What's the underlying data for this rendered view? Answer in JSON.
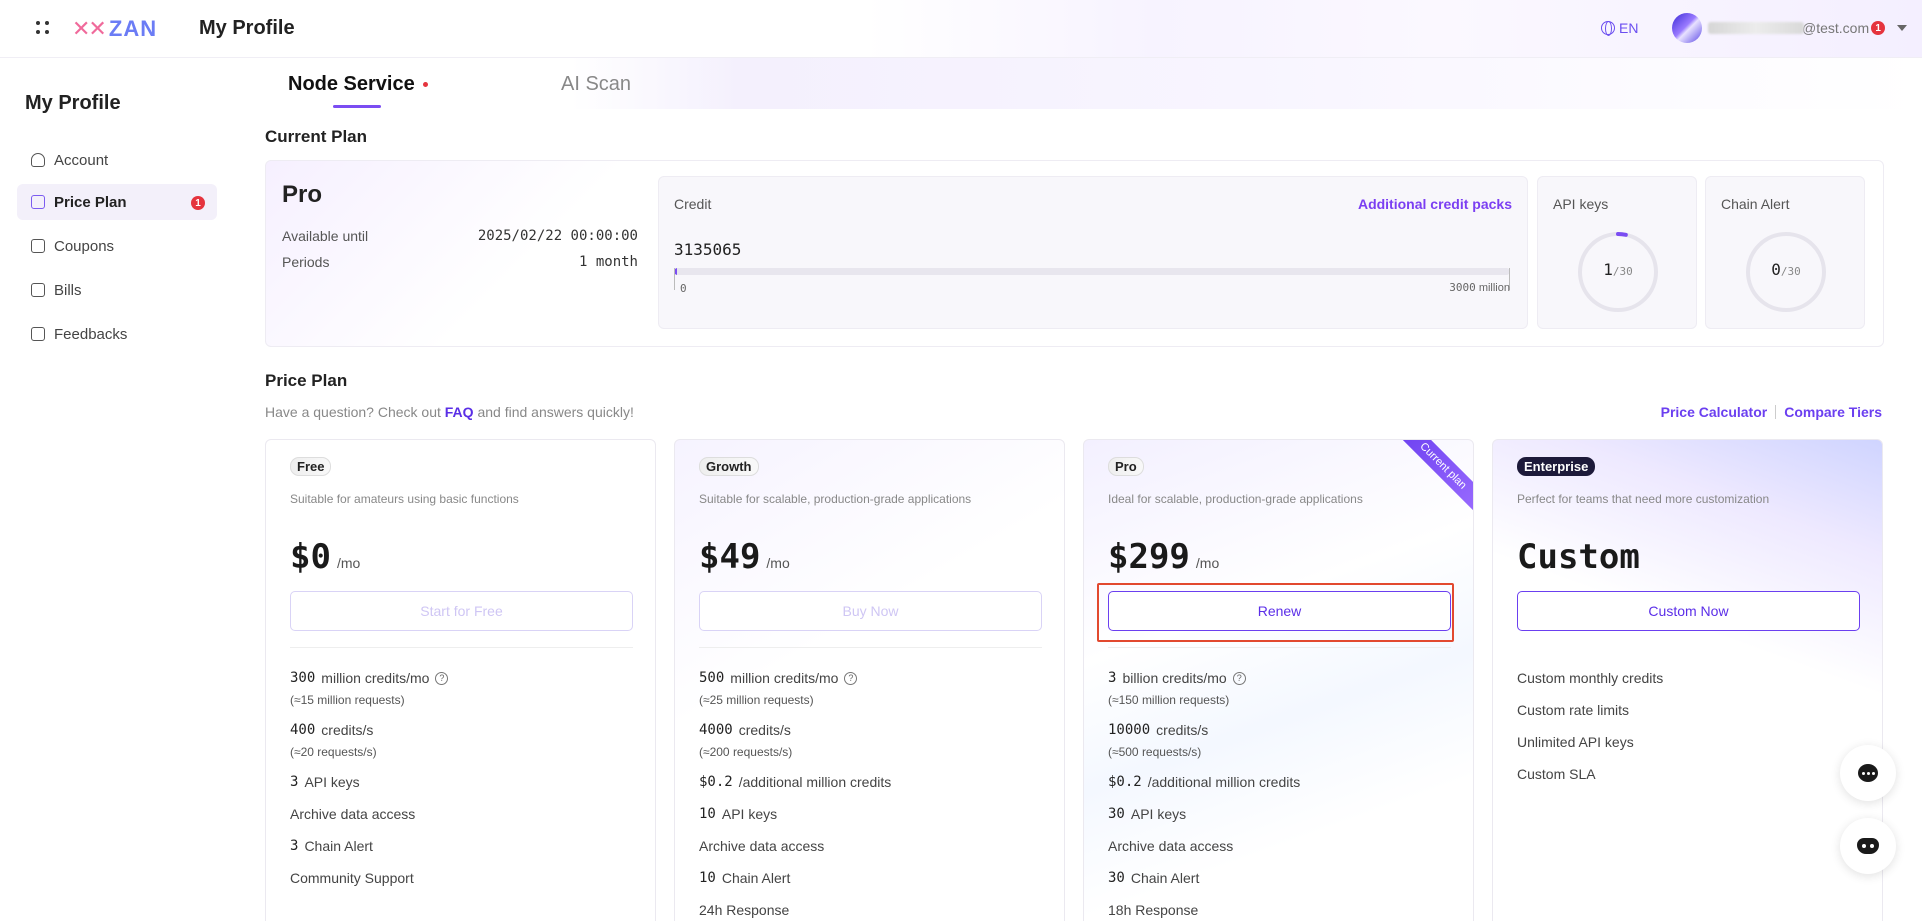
{
  "header": {
    "title": "My Profile",
    "logo": "ZAN",
    "lang": "EN",
    "email_suffix": "@test.com",
    "notif_count": "1"
  },
  "sidebar": {
    "title": "My Profile",
    "items": [
      {
        "label": "Account",
        "icon": "user-icon"
      },
      {
        "label": "Price Plan",
        "icon": "wallet-icon",
        "badge": "1"
      },
      {
        "label": "Coupons",
        "icon": "ticket-icon"
      },
      {
        "label": "Bills",
        "icon": "receipt-icon"
      },
      {
        "label": "Feedbacks",
        "icon": "message-icon"
      }
    ]
  },
  "tabs": {
    "node": "Node Service",
    "ai": "AI Scan"
  },
  "current_plan": {
    "section_title": "Current Plan",
    "name": "Pro",
    "available_label": "Available until",
    "available_value": "2025/02/22 00:00:00",
    "periods_label": "Periods",
    "periods_value": "1 month",
    "credit_label": "Credit",
    "credit_link": "Additional credit packs",
    "credit_value": "3135065",
    "credit_fraction": 0.001,
    "bar_min": "0",
    "bar_max_num": "3000",
    "bar_max_unit": "million",
    "api_keys_label": "API keys",
    "api_keys_used": "1",
    "api_keys_total": "/30",
    "api_keys_fraction": 0.033,
    "chain_alert_label": "Chain Alert",
    "chain_alert_used": "0",
    "chain_alert_total": "/30",
    "chain_alert_fraction": 0
  },
  "price_plan": {
    "section_title": "Price Plan",
    "sub_prefix": "Have a question? Check out",
    "faq": "FAQ",
    "sub_suffix": "and find answers quickly!",
    "calc_link": "Price Calculator",
    "compare_link": "Compare Tiers",
    "ribbon": "Current plan",
    "plans": [
      {
        "tag": "Free",
        "desc": "Suitable for amateurs using basic functions",
        "price": "$0",
        "per": "/mo",
        "button": "Start for Free",
        "f1n": "300",
        "f1t": "million credits/mo",
        "f1s": "(≈15 million requests)",
        "f2n": "400",
        "f2t": "credits/s",
        "f2s": "(≈20 requests/s)",
        "f3n": "3",
        "f3t": "API keys",
        "f4": "Archive data access",
        "f5n": "3",
        "f5t": "Chain Alert",
        "f6": "Community Support"
      },
      {
        "tag": "Growth",
        "desc": "Suitable for scalable, production-grade applications",
        "price": "$49",
        "per": "/mo",
        "button": "Buy Now",
        "f1n": "500",
        "f1t": "million credits/mo",
        "f1s": "(≈25 million requests)",
        "f2n": "4000",
        "f2t": "credits/s",
        "f2s": "(≈200 requests/s)",
        "f3n": "$0.2",
        "f3t": "/additional million credits",
        "f4n": "10",
        "f4t": "API keys",
        "f5": "Archive data access",
        "f6n": "10",
        "f6t": "Chain Alert",
        "f7": "24h Response"
      },
      {
        "tag": "Pro",
        "desc": "Ideal for scalable, production-grade applications",
        "price": "$299",
        "per": "/mo",
        "button": "Renew",
        "f1n": "3",
        "f1t": "billion credits/mo",
        "f1s": "(≈150 million requests)",
        "f2n": "10000",
        "f2t": "credits/s",
        "f2s": "(≈500 requests/s)",
        "f3n": "$0.2",
        "f3t": "/additional million credits",
        "f4n": "30",
        "f4t": "API keys",
        "f5": "Archive data access",
        "f6n": "30",
        "f6t": "Chain Alert",
        "f7": "18h Response"
      },
      {
        "tag": "Enterprise",
        "desc": "Perfect for teams that need more customization",
        "price": "Custom",
        "button": "Custom Now",
        "f1": "Custom monthly credits",
        "f2": "Custom rate limits",
        "f3": "Unlimited API keys",
        "f4": "Custom SLA"
      }
    ]
  },
  "colors": {
    "accent": "#7b4df2",
    "highlight": "#e2492f",
    "badge": "#e5343e"
  }
}
